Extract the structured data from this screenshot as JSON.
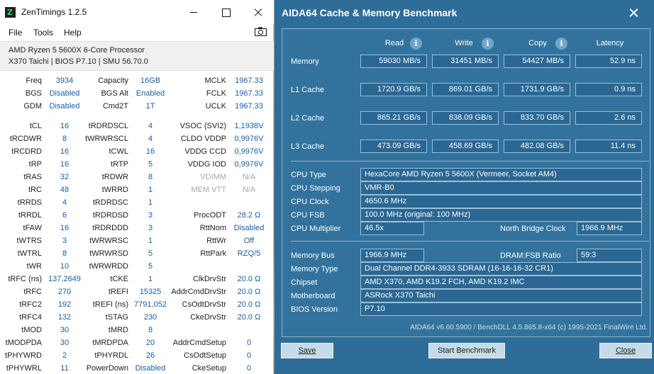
{
  "zentimings": {
    "app_title": "ZenTimings 1.2.5",
    "menu": [
      "File",
      "Tools",
      "Help"
    ],
    "cpu_line": "AMD Ryzen 5 5600X 6-Core Processor",
    "board_line": "X370 Taichi | BIOS P7.10 | SMU 56.70.0",
    "top": [
      {
        "l1": "Freq",
        "v1": "3934",
        "l2": "Capacity",
        "v2": "16GB",
        "l3": "MCLK",
        "v3": "1967.33"
      },
      {
        "l1": "BGS",
        "v1": "Disabled",
        "l2": "BGS Alt",
        "v2": "Enabled",
        "l3": "FCLK",
        "v3": "1967.33"
      },
      {
        "l1": "GDM",
        "v1": "Disabled",
        "l2": "Cmd2T",
        "v2": "1T",
        "l3": "UCLK",
        "v3": "1967.33"
      }
    ],
    "timings": [
      {
        "l1": "tCL",
        "v1": "16",
        "l2": "tRDRDSCL",
        "v2": "4",
        "l3": "VSOC (SVI2)",
        "v3": "1,1938V"
      },
      {
        "l1": "tRCDWR",
        "v1": "8",
        "l2": "tWRWRSCL",
        "v2": "4",
        "l3": "CLDO VDDP",
        "v3": "0,9976V"
      },
      {
        "l1": "tRCDRD",
        "v1": "16",
        "l2": "tCWL",
        "v2": "16",
        "l3": "VDDG CCD",
        "v3": "0,9976V"
      },
      {
        "l1": "tRP",
        "v1": "16",
        "l2": "tRTP",
        "v2": "5",
        "l3": "VDDG IOD",
        "v3": "0,9976V"
      },
      {
        "l1": "tRAS",
        "v1": "32",
        "l2": "tRDWR",
        "v2": "8",
        "l3": "VDIMM",
        "v3": "N/A"
      },
      {
        "l1": "tRC",
        "v1": "48",
        "l2": "tWRRD",
        "v2": "1",
        "l3": "MEM VTT",
        "v3": "N/A"
      },
      {
        "l1": "tRRDS",
        "v1": "4",
        "l2": "tRDRDSC",
        "v2": "1",
        "l3": "",
        "v3": ""
      },
      {
        "l1": "tRRDL",
        "v1": "6",
        "l2": "tRDRDSD",
        "v2": "3",
        "l3": "ProcODT",
        "v3": "28.2 Ω"
      },
      {
        "l1": "tFAW",
        "v1": "16",
        "l2": "tRDRDDD",
        "v2": "3",
        "l3": "RttNom",
        "v3": "Disabled"
      },
      {
        "l1": "tWTRS",
        "v1": "3",
        "l2": "tWRWRSC",
        "v2": "1",
        "l3": "RttWr",
        "v3": "Off"
      },
      {
        "l1": "tWTRL",
        "v1": "8",
        "l2": "tWRWRSD",
        "v2": "5",
        "l3": "RttPark",
        "v3": "RZQ/5"
      },
      {
        "l1": "tWR",
        "v1": "10",
        "l2": "tWRWRDD",
        "v2": "5",
        "l3": "",
        "v3": ""
      },
      {
        "l1": "tRFC (ns)",
        "v1": "137,2649",
        "l2": "tCKE",
        "v2": "1",
        "l3": "ClkDrvStr",
        "v3": "20.0 Ω"
      },
      {
        "l1": "tRFC",
        "v1": "270",
        "l2": "tREFI",
        "v2": "15325",
        "l3": "AddrCmdDrvStr",
        "v3": "20.0 Ω"
      },
      {
        "l1": "tRFC2",
        "v1": "192",
        "l2": "tREFI (ns)",
        "v2": "7791,052",
        "l3": "CsOdtDrvStr",
        "v3": "20.0 Ω"
      },
      {
        "l1": "tRFC4",
        "v1": "132",
        "l2": "tSTAG",
        "v2": "230",
        "l3": "CkeDrvStr",
        "v3": "20.0 Ω"
      },
      {
        "l1": "tMOD",
        "v1": "30",
        "l2": "tMRD",
        "v2": "8",
        "l3": "",
        "v3": ""
      },
      {
        "l1": "tMODPDA",
        "v1": "30",
        "l2": "tMRDPDA",
        "v2": "20",
        "l3": "AddrCmdSetup",
        "v3": "0"
      },
      {
        "l1": "tPHYWRD",
        "v1": "2",
        "l2": "tPHYRDL",
        "v2": "26",
        "l3": "CsOdtSetup",
        "v3": "0"
      },
      {
        "l1": "tPHYWRL",
        "v1": "11",
        "l2": "PowerDown",
        "v2": "Disabled",
        "l3": "CkeSetup",
        "v3": "0"
      }
    ]
  },
  "aida": {
    "title": "AIDA64 Cache & Memory Benchmark",
    "columns": {
      "read": "Read",
      "write": "Write",
      "copy": "Copy",
      "latency": "Latency"
    },
    "info_glyph": "i",
    "bench_rows": [
      {
        "label": "Memory",
        "read": "59030 MB/s",
        "write": "31451 MB/s",
        "copy": "54427 MB/s",
        "latency": "52.9 ns"
      },
      {
        "label": "L1 Cache",
        "read": "1720.9 GB/s",
        "write": "869.01 GB/s",
        "copy": "1731.9 GB/s",
        "latency": "0.9 ns"
      },
      {
        "label": "L2 Cache",
        "read": "865.21 GB/s",
        "write": "838.09 GB/s",
        "copy": "833.70 GB/s",
        "latency": "2.6 ns"
      },
      {
        "label": "L3 Cache",
        "read": "473.09 GB/s",
        "write": "458.69 GB/s",
        "copy": "482.08 GB/s",
        "latency": "11.4 ns"
      }
    ],
    "cpu_type_label": "CPU Type",
    "cpu_type": "HexaCore AMD Ryzen 5 5600X  (Vermeer, Socket AM4)",
    "cpu_stepping_label": "CPU Stepping",
    "cpu_stepping": "VMR-B0",
    "cpu_clock_label": "CPU Clock",
    "cpu_clock": "4650.6 MHz",
    "cpu_fsb_label": "CPU FSB",
    "cpu_fsb": "100.0 MHz  (original: 100 MHz)",
    "cpu_mult_label": "CPU Multiplier",
    "cpu_mult": "46.5x",
    "nb_clock_label": "North Bridge Clock",
    "nb_clock": "1966.9 MHz",
    "mem_bus_label": "Memory Bus",
    "mem_bus": "1966.9 MHz",
    "dram_ratio_label": "DRAM:FSB Ratio",
    "dram_ratio": "59:3",
    "mem_type_label": "Memory Type",
    "mem_type": "Dual Channel DDR4-3933 SDRAM  (16-16-16-32 CR1)",
    "chipset_label": "Chipset",
    "chipset": "AMD X370, AMD K19.2 FCH, AMD K19.2 IMC",
    "motherboard_label": "Motherboard",
    "motherboard": "ASRock X370 Taichi",
    "bios_label": "BIOS Version",
    "bios": "P7.10",
    "footer": "AIDA64 v6.60.5900 / BenchDLL 4.5.865.8-x64  (c) 1995-2021 FinalWire Ltd.",
    "buttons": {
      "save": "Save",
      "start": "Start Benchmark",
      "close": "Close"
    }
  }
}
